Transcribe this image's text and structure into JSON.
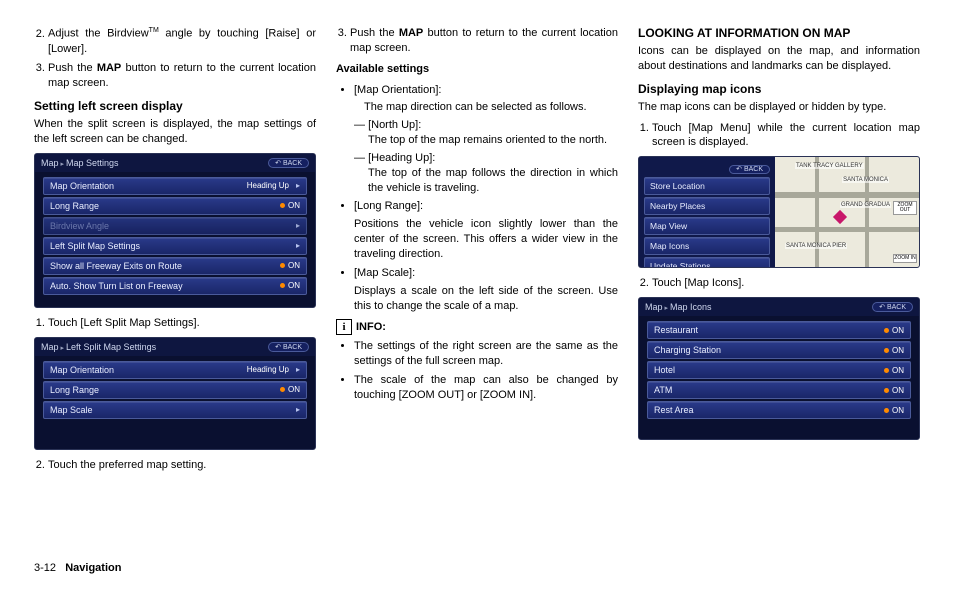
{
  "col1": {
    "step2a": "Adjust the Birdview",
    "tm": "TM",
    "step2b": " angle by touching [Raise] or [Lower].",
    "step3a": "Push the ",
    "mapBtn": "MAP",
    "step3b": " button to return to the current location map screen.",
    "h_setting": "Setting left screen display",
    "p_setting": "When the split screen is displayed, the map settings of the left screen can be changed.",
    "box1": {
      "crumb1": "Map",
      "crumb2": "Map Settings",
      "back": "BACK",
      "rows": [
        {
          "label": "Map Orientation",
          "right": "Heading Up",
          "mode": "chev"
        },
        {
          "label": "Long Range",
          "right": "ON",
          "mode": "on"
        },
        {
          "label": "Birdview Angle",
          "right": "",
          "mode": "dim"
        },
        {
          "label": "Left Split Map Settings",
          "right": "",
          "mode": "chev"
        },
        {
          "label": "Show all Freeway Exits on Route",
          "right": "ON",
          "mode": "on"
        },
        {
          "label": "Auto. Show Turn List on Freeway",
          "right": "ON",
          "mode": "on"
        }
      ]
    },
    "step_b1": "Touch [Left Split Map Settings].",
    "box2": {
      "crumb1": "Map",
      "crumb2": "Left Split Map Settings",
      "back": "BACK",
      "rows": [
        {
          "label": "Map Orientation",
          "right": "Heading Up",
          "mode": "chev"
        },
        {
          "label": "Long Range",
          "right": "ON",
          "mode": "on"
        },
        {
          "label": "Map Scale",
          "right": "",
          "mode": "chev"
        }
      ]
    },
    "step_b2": "Touch the preferred map setting."
  },
  "col2": {
    "step3a": "Push the ",
    "mapBtn": "MAP",
    "step3b": " button to return to the current location map screen.",
    "h_avail": "Available settings",
    "mo_label": "[Map Orientation]:",
    "mo_text": "The map direction can be selected as follows.",
    "nu_label": "[North Up]:",
    "nu_text": "The top of the map remains oriented to the north.",
    "hu_label": "[Heading Up]:",
    "hu_text": "The top of the map follows the direction in which the vehicle is traveling.",
    "lr_label": "[Long Range]:",
    "lr_text": "Positions the vehicle icon slightly lower than the center of the screen. This offers a wider view in the traveling direction.",
    "ms_label": "[Map Scale]:",
    "ms_text": "Displays a scale on the left side of the screen. Use this to change the scale of a map.",
    "info_hdr": "INFO:",
    "info1": "The settings of the right screen are the same as the settings of the full screen map.",
    "info2": "The scale of the map can also be changed by touching [ZOOM OUT] or [ZOOM IN]."
  },
  "col3": {
    "h_looking": "LOOKING AT INFORMATION ON MAP",
    "p_looking": "Icons can be displayed on the map, and information about destinations and landmarks can be displayed.",
    "h_disp": "Displaying map icons",
    "p_disp": "The map icons can be displayed or hidden by type.",
    "step1": "Touch [Map Menu] while the current location map screen is displayed.",
    "mapbox": {
      "back": "BACK",
      "items": [
        "Store Location",
        "Nearby Places",
        "Map View",
        "Map Icons",
        "Update Stations"
      ],
      "poi1": "TANK TRACY GALLERY",
      "poi2": "SANTA MONICA",
      "poi3": "GRAND GRADUA",
      "poi4": "SANTA MONICA PIER",
      "zout": "ZOOM OUT",
      "zin": "ZOOM IN"
    },
    "step2": "Touch [Map Icons].",
    "box3": {
      "crumb1": "Map",
      "crumb2": "Map Icons",
      "back": "BACK",
      "rows": [
        {
          "label": "Restaurant",
          "right": "ON",
          "mode": "on"
        },
        {
          "label": "Charging Station",
          "right": "ON",
          "mode": "on"
        },
        {
          "label": "Hotel",
          "right": "ON",
          "mode": "on"
        },
        {
          "label": "ATM",
          "right": "ON",
          "mode": "on"
        },
        {
          "label": "Rest Area",
          "right": "ON",
          "mode": "on"
        }
      ]
    }
  },
  "footer": {
    "page": "3-12",
    "section": "Navigation"
  }
}
